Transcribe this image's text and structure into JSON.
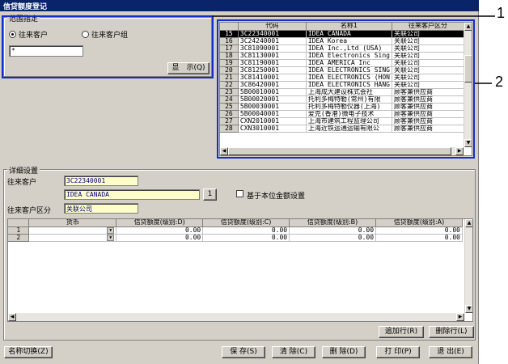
{
  "window": {
    "title": "信贷额度登记"
  },
  "filter": {
    "legend": "范围指定",
    "radio_customer": "往来客户",
    "radio_group": "往来客户组",
    "search_value": "*",
    "show_button": "显　示(Q)"
  },
  "list": {
    "headers": [
      "",
      "代码",
      "名称1",
      "往来客户区分"
    ],
    "rows": [
      {
        "no": "15",
        "code": "3C22340001",
        "name": "IDEA CANADA",
        "type": "关联公司",
        "selected": true
      },
      {
        "no": "16",
        "code": "3C24240001",
        "name": "IDEA Korea",
        "type": "关联公司"
      },
      {
        "no": "17",
        "code": "3C81090001",
        "name": "IDEA Inc.,Ltd (USA)",
        "type": "关联公司"
      },
      {
        "no": "18",
        "code": "3C81130001",
        "name": "IDEA Electronics Sing",
        "type": "关联公司"
      },
      {
        "no": "19",
        "code": "3C81190001",
        "name": "IDEA AMERICA Inc",
        "type": "关联公司"
      },
      {
        "no": "20",
        "code": "3C81250001",
        "name": "IDEA ELECTRONICS SING",
        "type": "关联公司"
      },
      {
        "no": "21",
        "code": "3C81410001",
        "name": "IDEA ELECTRONICS (HON",
        "type": "关联公司"
      },
      {
        "no": "22",
        "code": "3C86420001",
        "name": "IDEA ELECTRONICS HANG",
        "type": "关联公司"
      },
      {
        "no": "23",
        "code": "5B00010001",
        "name": "上海成大建设株式会社",
        "type": "顾客兼供应商"
      },
      {
        "no": "24",
        "code": "5B00020001",
        "name": "托利多梅特勒(常州)有限",
        "type": "顾客兼供应商"
      },
      {
        "no": "25",
        "code": "5B00030001",
        "name": "托利多梅特勒仪器(上海)",
        "type": "顾客兼供应商"
      },
      {
        "no": "26",
        "code": "5B00040001",
        "name": "爱克(香港)微电子技术",
        "type": "顾客兼供应商"
      },
      {
        "no": "27",
        "code": "CXN2010001",
        "name": "上海市建筑工程监理公司",
        "type": "顾客兼供应商"
      },
      {
        "no": "28",
        "code": "CXN3010001",
        "name": "上海近铁运通运输有限公",
        "type": "顾客兼供应商"
      }
    ]
  },
  "detail": {
    "legend": "详细设置",
    "customer_label": "往来客户",
    "customer_code": "3C22340001",
    "customer_name": "IDEA CANADA",
    "lookup_button": "1",
    "type_label": "往来客户区分",
    "type_value": "关联公司",
    "base_amount_check": "基于本位金额设置",
    "grid_headers": [
      "",
      "货币",
      "信贷额度(级别:D)",
      "信贷额度(级别:C)",
      "信贷额度(级别:B)",
      "信贷额度(级别:A)"
    ],
    "grid_rows": [
      {
        "no": "1",
        "currency": "",
        "d": "0.00",
        "c": "0.00",
        "b": "0.00",
        "a": "0.00"
      },
      {
        "no": "2",
        "currency": "",
        "d": "0.00",
        "c": "0.00",
        "b": "0.00",
        "a": "0.00"
      }
    ],
    "add_row": "追加行(R)",
    "delete_row": "删除行(L)"
  },
  "footer": {
    "name_switch": "名称切换(Z)",
    "save": "保 存(S)",
    "clear": "清 除(C)",
    "delete": "删 除(D)",
    "print": "打 印(P)",
    "exit": "退 出(E)"
  },
  "callouts": {
    "one": "1",
    "two": "2"
  },
  "colors": {
    "titlebar": "#0a246a",
    "highlight_box": "#1230c8",
    "field_yellow": "#ffffcc"
  }
}
